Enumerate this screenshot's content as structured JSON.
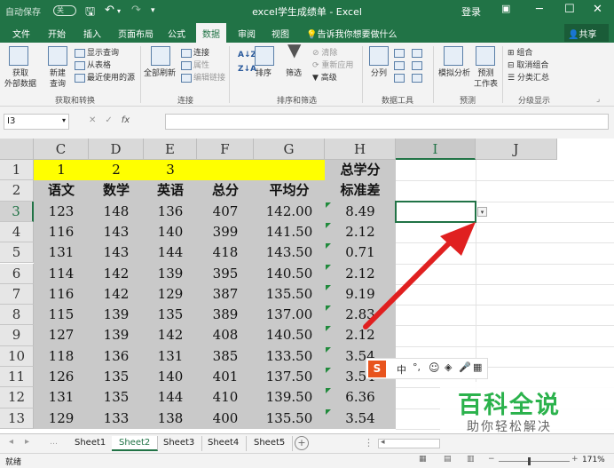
{
  "titlebar": {
    "autosave": "自动保存",
    "autosave_state": "关",
    "title": "excel学生成绩单  -  Excel",
    "login": "登录",
    "minimize": "─",
    "restore": "☐",
    "close": "✕"
  },
  "tabs": [
    "文件",
    "开始",
    "插入",
    "页面布局",
    "公式",
    "数据",
    "审阅",
    "视图"
  ],
  "active_tab": "数据",
  "tellme": "告诉我你想要做什么",
  "share": "共享",
  "ribbon": {
    "get_external": "获取\n外部数据",
    "new_query": "新建\n查询",
    "show_query": "显示查询",
    "from_table": "从表格",
    "recent_sources": "最近使用的源",
    "group1": "获取和转换",
    "refresh_all": "全部刷新",
    "connections": "连接",
    "properties": "属性",
    "edit_links": "编辑链接",
    "group2": "连接",
    "sort": "排序",
    "filter": "筛选",
    "clear": "清除",
    "reapply": "重新应用",
    "advanced": "高级",
    "group3": "排序和筛选",
    "text_to_columns": "分列",
    "group4": "数据工具",
    "what_if": "模拟分析",
    "forecast_sheet": "预测\n工作表",
    "group5": "预测",
    "group_btn": "组合",
    "ungroup": "取消组合",
    "subtotal": "分类汇总",
    "group6": "分级显示"
  },
  "formula_bar": {
    "name_box": "I3",
    "fx": "fx",
    "formula": ""
  },
  "columns": [
    "C",
    "D",
    "E",
    "F",
    "G",
    "H",
    "I",
    "J"
  ],
  "rows": [
    "1",
    "2",
    "3",
    "4",
    "5",
    "6",
    "7",
    "8",
    "9",
    "10",
    "11",
    "12",
    "13"
  ],
  "header_row1": [
    "1",
    "2",
    "3",
    "",
    "",
    "总学分"
  ],
  "header_row2": [
    "语文",
    "数学",
    "英语",
    "总分",
    "平均分",
    "标准差"
  ],
  "data_rows": [
    [
      "123",
      "148",
      "136",
      "407",
      "142.00",
      "8.49"
    ],
    [
      "116",
      "143",
      "140",
      "399",
      "141.50",
      "2.12"
    ],
    [
      "131",
      "143",
      "144",
      "418",
      "143.50",
      "0.71"
    ],
    [
      "114",
      "142",
      "139",
      "395",
      "140.50",
      "2.12"
    ],
    [
      "116",
      "142",
      "129",
      "387",
      "135.50",
      "9.19"
    ],
    [
      "115",
      "139",
      "135",
      "389",
      "137.00",
      "2.83"
    ],
    [
      "127",
      "139",
      "142",
      "408",
      "140.50",
      "2.12"
    ],
    [
      "118",
      "136",
      "131",
      "385",
      "133.50",
      "3.54"
    ],
    [
      "126",
      "135",
      "140",
      "401",
      "137.50",
      "3.54"
    ],
    [
      "131",
      "135",
      "144",
      "410",
      "139.50",
      "6.36"
    ],
    [
      "129",
      "133",
      "138",
      "400",
      "135.50",
      "3.54"
    ]
  ],
  "sheets": [
    "Sheet1",
    "Sheet2",
    "Sheet3",
    "Sheet4",
    "Sheet5"
  ],
  "active_sheet": "Sheet2",
  "status": {
    "ready": "就绪",
    "zoom": "171%"
  },
  "ime": {
    "logo": "S",
    "mode": "中"
  },
  "watermark": {
    "title": "百科全说",
    "subtitle": "助你轻松解决"
  },
  "colors": {
    "excel_green": "#217346",
    "highlight_yellow": "#ffff00",
    "arrow_red": "#e02020",
    "watermark_green": "#2bb24c"
  }
}
